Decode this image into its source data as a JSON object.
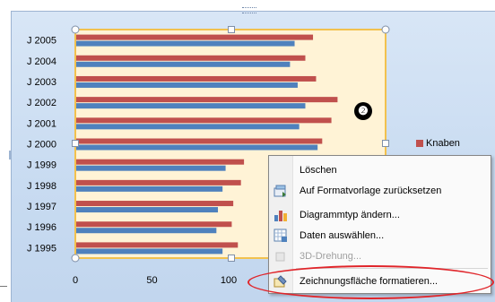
{
  "chart_data": {
    "type": "bar",
    "orientation": "horizontal",
    "categories": [
      "J 1995",
      "J 1996",
      "J 1997",
      "J 1998",
      "J 1999",
      "J 2000",
      "J 2001",
      "J 2002",
      "J 2003",
      "J 2004",
      "J 2005"
    ],
    "series": [
      {
        "name": "Knaben",
        "color": "#c0504d",
        "values": [
          106,
          102,
          103,
          108,
          110,
          161,
          167,
          171,
          157,
          150,
          155
        ]
      },
      {
        "name": "",
        "color": "#4f81bd",
        "values": [
          96,
          92,
          93,
          96,
          98,
          158,
          146,
          150,
          145,
          140,
          143
        ]
      }
    ],
    "x_ticks": [
      "0",
      "50",
      "100"
    ],
    "xlim": [
      0,
      100
    ],
    "legend": "right"
  },
  "marker": {
    "label": "❷"
  },
  "context_menu": {
    "items": [
      {
        "label": "Löschen",
        "icon": "none",
        "enabled": true
      },
      {
        "label": "Auf Formatvorlage zurücksetzen",
        "icon": "reset-style-icon",
        "enabled": true
      },
      {
        "label": "Diagrammtyp ändern...",
        "icon": "chart-type-icon",
        "enabled": true
      },
      {
        "label": "Daten auswählen...",
        "icon": "select-data-icon",
        "enabled": true
      },
      {
        "label": "3D-Drehung...",
        "icon": "3d-rotation-icon",
        "enabled": false
      },
      {
        "label": "Zeichnungsfläche formatieren...",
        "icon": "format-plot-area-icon",
        "enabled": true
      }
    ]
  },
  "colors": {
    "highlight": "#e0252a",
    "plot_area_bg": "#fff3d6",
    "selection": "#f2c14e"
  }
}
